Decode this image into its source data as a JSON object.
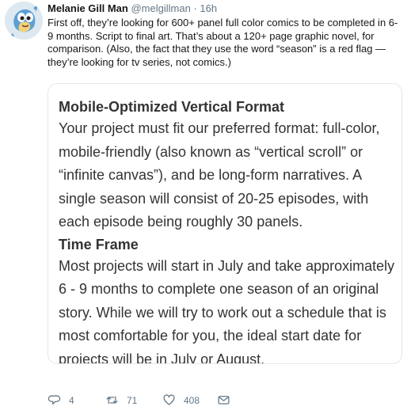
{
  "tweet": {
    "author_name": "Melanie Gill Man",
    "handle": "@melgillman",
    "separator": "·",
    "time": "16h",
    "text": "First off, they’re looking for 600+ panel full color comics to be completed in 6-9 months.  Script to final art.  That’s about a 120+ page graphic novel, for comparison.  (Also, the fact that they use the word “season” is a red flag — they’re looking for tv series, not comics.)",
    "card": {
      "section1_title": "Mobile-Optimized Vertical Format",
      "section1_body": "Your project must fit our preferred format: full-color, mobile-friendly (also known as “vertical scroll” or “infinite canvas”), and be long-form narratives. A single season will consist of 20-25 episodes, with each episode being roughly 30 panels.",
      "section2_title": "Time Frame",
      "section2_body": "Most projects will start in July and take approximately 6 - 9 months to complete one season of an original story. While we will try to work out a schedule that is most comfortable for you, the ideal start date for projects will be in July or August."
    },
    "actions": {
      "reply_count": "4",
      "retweet_count": "71",
      "like_count": "408",
      "icons": [
        "reply-icon",
        "retweet-icon",
        "like-icon",
        "message-icon"
      ]
    }
  },
  "colors": {
    "text": "#14171a",
    "secondary": "#657786",
    "card_border": "#e1e8ed",
    "card_text": "#333333"
  }
}
